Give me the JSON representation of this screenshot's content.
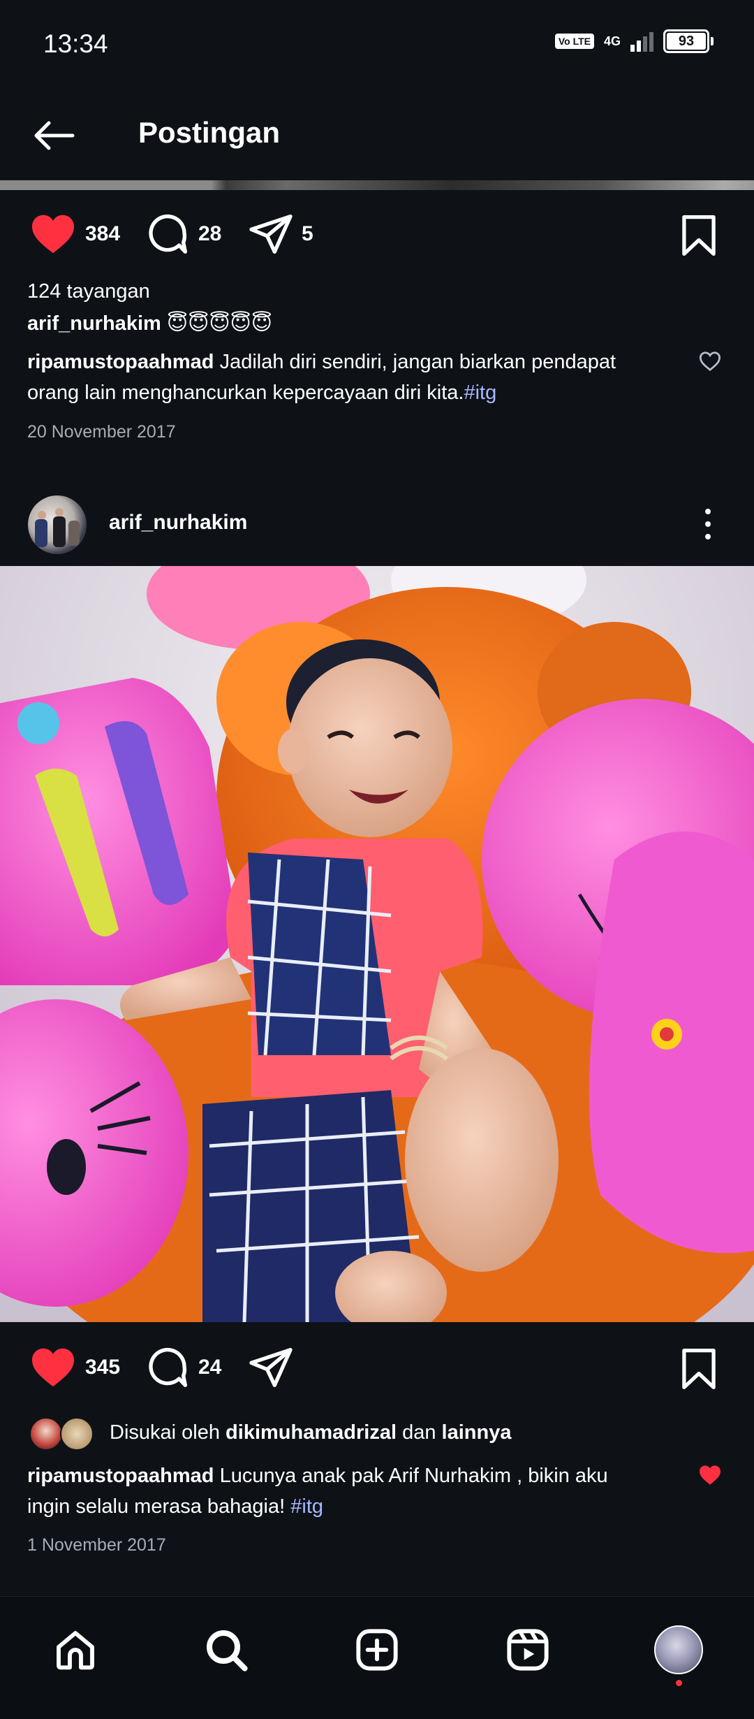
{
  "status_bar": {
    "time": "13:34",
    "volte": "Vo LTE",
    "network": "4G",
    "battery": "93"
  },
  "header": {
    "title": "Postingan"
  },
  "post1": {
    "likes": "384",
    "comments": "28",
    "shares": "5",
    "views": "124 tayangan",
    "author": "arif_nurhakim",
    "author_emojis": "😇😇😇😇😇",
    "comment_user": "ripamustopaahmad",
    "comment_text": "Jadilah diri sendiri, jangan biarkan pendapat orang lain menghancurkan kepercayaan diri kita.",
    "comment_tag": "#itg",
    "date": "20 November 2017"
  },
  "post2": {
    "author": "arif_nurhakim",
    "likes": "345",
    "comments": "24",
    "liked_by_prefix": "Disukai oleh",
    "liked_by_user": "dikimuhamadrizal",
    "liked_by_and": "dan",
    "liked_by_others": "lainnya",
    "comment_user": "ripamustopaahmad",
    "comment_text": "Lucunya anak pak Arif Nurhakim , bikin aku ingin selalu merasa bahagia!",
    "comment_tag": "#itg",
    "date": "1 November 2017"
  },
  "colors": {
    "background": "#0e1217",
    "like_red": "#ff3040",
    "hashtag": "#a8b8ff",
    "muted_text": "#a8adb3"
  },
  "nav": [
    "home-icon",
    "search-icon",
    "create-icon",
    "reels-icon",
    "profile-avatar"
  ]
}
